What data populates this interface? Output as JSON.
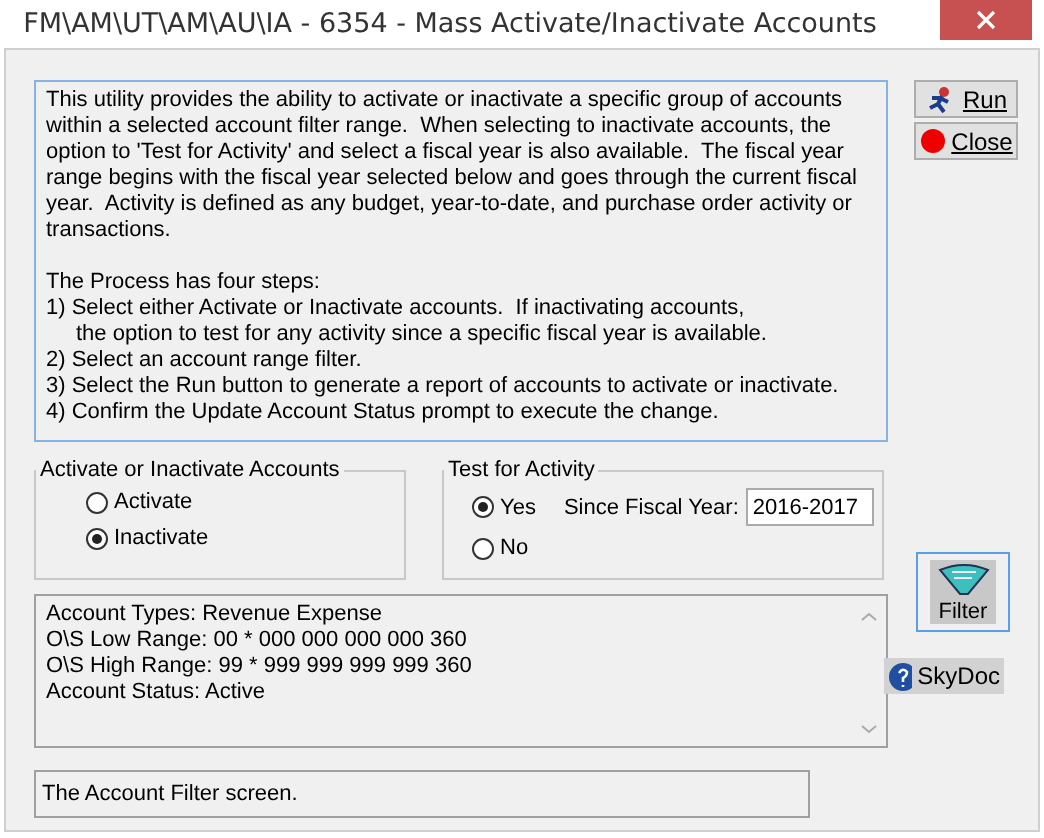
{
  "window": {
    "title": "FM\\AM\\UT\\AM\\AU\\IA - 6354 - Mass Activate/Inactivate Accounts"
  },
  "description": {
    "intro": [
      "This utility provides the ability to activate or inactivate a specific group of accounts",
      "within a selected account filter range.  When selecting to inactivate accounts, the",
      "option to 'Test for Activity' and select a fiscal year is also available.  The fiscal year",
      "range begins with the fiscal year selected below and goes through the current fiscal",
      "year.  Activity is defined as any budget, year-to-date, and purchase order activity or",
      "transactions."
    ],
    "steps_title": "The Process has four steps:",
    "steps": [
      {
        "text": "1) Select either Activate or Inactivate accounts.  If inactivating accounts,",
        "indent": false
      },
      {
        "text": "the option to test for any activity since a specific fiscal year is available.",
        "indent": true
      },
      {
        "text": "2) Select an account range filter.",
        "indent": false
      },
      {
        "text": "3) Select the Run button to generate a report of accounts to activate or inactivate.",
        "indent": false
      },
      {
        "text": "4) Confirm the Update Account Status prompt to execute the change.",
        "indent": false
      }
    ]
  },
  "buttons": [
    {
      "label": "Run",
      "kind": "run"
    },
    {
      "label": "Close",
      "kind": "close"
    }
  ],
  "mode_group": {
    "title": "Activate or Inactivate Accounts",
    "options": [
      {
        "label": "Activate",
        "selected": false
      },
      {
        "label": "Inactivate",
        "selected": true
      }
    ]
  },
  "activity_group": {
    "title": "Test for Activity",
    "options": [
      {
        "label": "Yes",
        "selected": true
      },
      {
        "label": "No",
        "selected": false
      }
    ],
    "fiscal_year_label": "Since Fiscal Year:",
    "fiscal_year_value": "2016-2017"
  },
  "filter_summary": [
    "Account Types: Revenue Expense",
    "O\\S Low Range: 00 * 000 000 000 000 360",
    "O\\S High Range: 99 * 999 999 999 999 360",
    "Account Status: Active"
  ],
  "filter_button": {
    "label": "Filter"
  },
  "status_bar": {
    "text": "The Account Filter screen."
  },
  "help_button": {
    "label": "SkyDoc"
  }
}
